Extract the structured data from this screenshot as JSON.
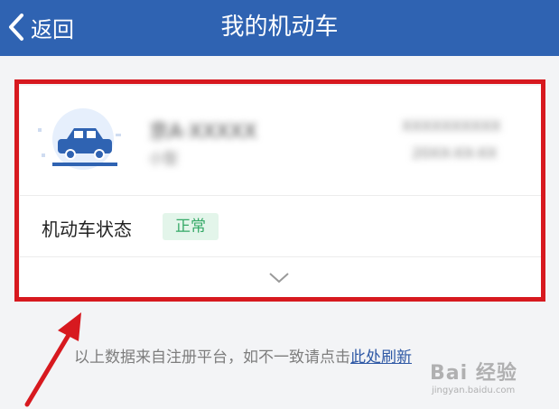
{
  "header": {
    "back_label": "返回",
    "title": "我的机动车"
  },
  "vehicle": {
    "plate_blurred": "京A·XXXXX",
    "type_blurred": "小型",
    "right_top_blurred": "XXXXXXXXXX",
    "right_bottom_blurred": "20XX-XX-XX"
  },
  "status": {
    "label": "机动车状态",
    "value": "正常"
  },
  "notice": {
    "text": "以上数据来自注册平台，如不一致请点击",
    "link": "此处刷新"
  },
  "watermark": {
    "main": "Bai 经验",
    "sub": "jingyan.baidu.com"
  },
  "colors": {
    "header": "#2f63b2",
    "highlight_frame": "#d7191f",
    "status_badge_bg": "#e3f5ea",
    "status_badge_text": "#35a967",
    "arrow": "#d7191f"
  }
}
